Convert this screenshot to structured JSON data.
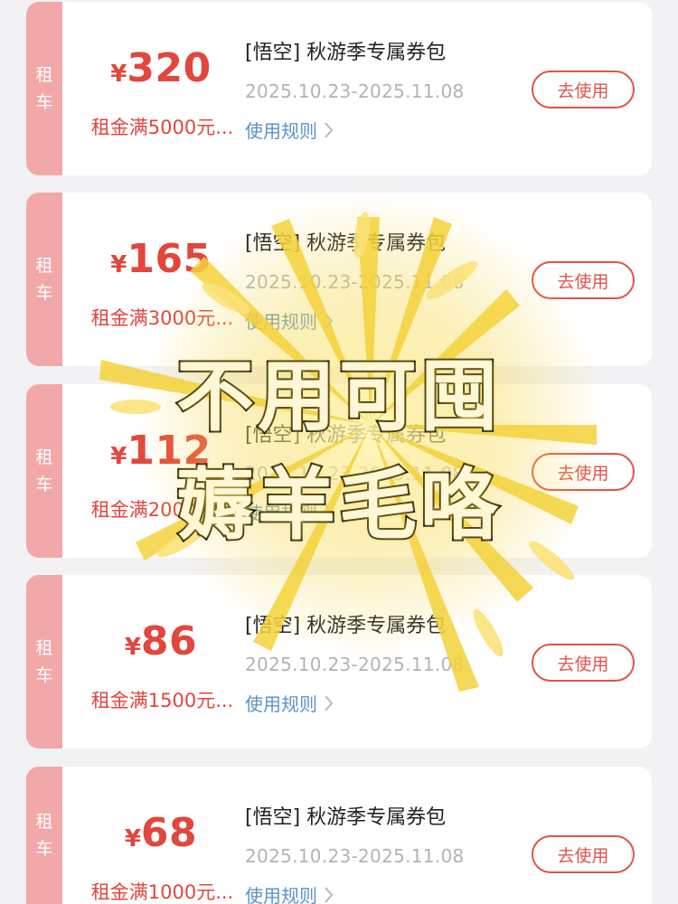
{
  "coupons": [
    {
      "tag_chars": [
        "租",
        "车"
      ],
      "currency": "¥",
      "amount": "320",
      "condition": "租金满5000元...",
      "title": "[悟空] 秋游季专属券包",
      "dates": "2025.10.23-2025.11.08",
      "rules_label": "使用规则",
      "button_label": "去使用"
    },
    {
      "tag_chars": [
        "租",
        "车"
      ],
      "currency": "¥",
      "amount": "165",
      "condition": "租金满3000元...",
      "title": "[悟空] 秋游季专属券包",
      "dates": "2025.10.23-2025.11.08",
      "rules_label": "使用规则",
      "button_label": "去使用"
    },
    {
      "tag_chars": [
        "租",
        "车"
      ],
      "currency": "¥",
      "amount": "112",
      "condition": "租金满2000元...",
      "title": "[悟空] 秋游季专属券包",
      "dates": "2025.10.23-2025.11.08",
      "rules_label": "使用规则",
      "button_label": "去使用"
    },
    {
      "tag_chars": [
        "租",
        "车"
      ],
      "currency": "¥",
      "amount": "86",
      "condition": "租金满1500元...",
      "title": "[悟空] 秋游季专属券包",
      "dates": "2025.10.23-2025.11.08",
      "rules_label": "使用规则",
      "button_label": "去使用"
    },
    {
      "tag_chars": [
        "租",
        "车"
      ],
      "currency": "¥",
      "amount": "68",
      "condition": "租金满1000元...",
      "title": "[悟空] 秋游季专属券包",
      "dates": "2025.10.23-2025.11.08",
      "rules_label": "使用规则",
      "button_label": "去使用"
    }
  ],
  "overlay": {
    "line1": "不用可囤",
    "line2": "薅羊毛咯"
  },
  "icons": {
    "rules_arrow": "chevron-right-icon",
    "burst": "firework-burst-decoration"
  },
  "colors": {
    "accent": "#e2463c",
    "tag_bg": "#f2a8a8",
    "link": "#5a93c9",
    "muted": "#b3b3b3",
    "page_bg": "#f2f2f4",
    "burst": "#f4d23a"
  }
}
